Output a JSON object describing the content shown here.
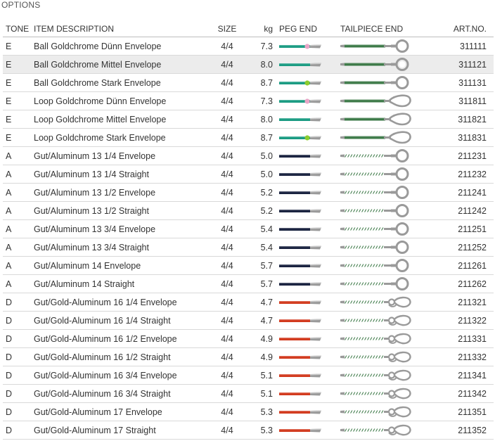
{
  "title": "OPTIONS",
  "headers": {
    "tone": "TONE",
    "description": "ITEM DESCRIPTION",
    "size": "SIZE",
    "kg": "kg",
    "peg": "PEG END",
    "tail": "TAILPIECE END",
    "art": "ART.NO."
  },
  "colors": {
    "teal": "#1a9b82",
    "green": "#3d7a48",
    "navy": "#1a2340",
    "red": "#d23a1e",
    "pink": "#e9a6c7",
    "lime": "#8ccc2f",
    "metal": "#9a9a9a",
    "highlight_row": "#ececec"
  },
  "rows": [
    {
      "tone": "E",
      "desc": "Ball Goldchrome Dünn Envelope",
      "size": "4/4",
      "kg": "7.3",
      "art": "311111",
      "peg": "teal-pink",
      "tail": "ball-green",
      "highlight": false
    },
    {
      "tone": "E",
      "desc": "Ball Goldchrome Mittel Envelope",
      "size": "4/4",
      "kg": "8.0",
      "art": "311121",
      "peg": "teal",
      "tail": "ball-green",
      "highlight": true
    },
    {
      "tone": "E",
      "desc": "Ball Goldchrome Stark Envelope",
      "size": "4/4",
      "kg": "8.7",
      "art": "311131",
      "peg": "teal-lime",
      "tail": "ball-green",
      "highlight": false
    },
    {
      "tone": "E",
      "desc": "Loop Goldchrome Dünn Envelope",
      "size": "4/4",
      "kg": "7.3",
      "art": "311811",
      "peg": "teal-pink",
      "tail": "loop-green",
      "highlight": false
    },
    {
      "tone": "E",
      "desc": "Loop Goldchrome Mittel Envelope",
      "size": "4/4",
      "kg": "8.0",
      "art": "311821",
      "peg": "teal",
      "tail": "loop-green",
      "highlight": false
    },
    {
      "tone": "E",
      "desc": "Loop Goldchrome Stark Envelope",
      "size": "4/4",
      "kg": "8.7",
      "art": "311831",
      "peg": "teal-lime",
      "tail": "loop-green",
      "highlight": false
    },
    {
      "tone": "A",
      "desc": "Gut/Aluminum 13 1/4 Envelope",
      "size": "4/4",
      "kg": "5.0",
      "art": "211231",
      "peg": "navy",
      "tail": "ball-striped",
      "highlight": false
    },
    {
      "tone": "A",
      "desc": "Gut/Aluminum 13 1/4 Straight",
      "size": "4/4",
      "kg": "5.0",
      "art": "211232",
      "peg": "navy",
      "tail": "ball-striped",
      "highlight": false
    },
    {
      "tone": "A",
      "desc": "Gut/Aluminum 13 1/2 Envelope",
      "size": "4/4",
      "kg": "5.2",
      "art": "211241",
      "peg": "navy",
      "tail": "ball-striped",
      "highlight": false
    },
    {
      "tone": "A",
      "desc": "Gut/Aluminum 13 1/2 Straight",
      "size": "4/4",
      "kg": "5.2",
      "art": "211242",
      "peg": "navy",
      "tail": "ball-striped",
      "highlight": false
    },
    {
      "tone": "A",
      "desc": "Gut/Aluminum 13 3/4 Envelope",
      "size": "4/4",
      "kg": "5.4",
      "art": "211251",
      "peg": "navy",
      "tail": "ball-striped",
      "highlight": false
    },
    {
      "tone": "A",
      "desc": "Gut/Aluminum 13 3/4 Straight",
      "size": "4/4",
      "kg": "5.4",
      "art": "211252",
      "peg": "navy",
      "tail": "ball-striped",
      "highlight": false
    },
    {
      "tone": "A",
      "desc": "Gut/Aluminum 14 Envelope",
      "size": "4/4",
      "kg": "5.7",
      "art": "211261",
      "peg": "navy",
      "tail": "ball-striped",
      "highlight": false
    },
    {
      "tone": "A",
      "desc": "Gut/Aluminum 14 Straight",
      "size": "4/4",
      "kg": "5.7",
      "art": "211262",
      "peg": "navy",
      "tail": "ball-striped",
      "highlight": false
    },
    {
      "tone": "D",
      "desc": "Gut/Gold-Aluminum 16 1/4 Envelope",
      "size": "4/4",
      "kg": "4.7",
      "art": "211321",
      "peg": "red",
      "tail": "knot-striped",
      "highlight": false
    },
    {
      "tone": "D",
      "desc": "Gut/Gold-Aluminum 16 1/4 Straight",
      "size": "4/4",
      "kg": "4.7",
      "art": "211322",
      "peg": "red",
      "tail": "knot-striped",
      "highlight": false
    },
    {
      "tone": "D",
      "desc": "Gut/Gold-Aluminum 16 1/2 Envelope",
      "size": "4/4",
      "kg": "4.9",
      "art": "211331",
      "peg": "red",
      "tail": "knot-striped",
      "highlight": false
    },
    {
      "tone": "D",
      "desc": "Gut/Gold-Aluminum 16 1/2 Straight",
      "size": "4/4",
      "kg": "4.9",
      "art": "211332",
      "peg": "red",
      "tail": "knot-striped",
      "highlight": false
    },
    {
      "tone": "D",
      "desc": "Gut/Gold-Aluminum 16 3/4 Envelope",
      "size": "4/4",
      "kg": "5.1",
      "art": "211341",
      "peg": "red",
      "tail": "knot-striped",
      "highlight": false
    },
    {
      "tone": "D",
      "desc": "Gut/Gold-Aluminum 16 3/4 Straight",
      "size": "4/4",
      "kg": "5.1",
      "art": "211342",
      "peg": "red",
      "tail": "knot-striped",
      "highlight": false
    },
    {
      "tone": "D",
      "desc": "Gut/Gold-Aluminum 17 Envelope",
      "size": "4/4",
      "kg": "5.3",
      "art": "211351",
      "peg": "red",
      "tail": "knot-striped",
      "highlight": false
    },
    {
      "tone": "D",
      "desc": "Gut/Gold-Aluminum 17 Straight",
      "size": "4/4",
      "kg": "5.3",
      "art": "211352",
      "peg": "red",
      "tail": "knot-striped",
      "highlight": false
    }
  ]
}
